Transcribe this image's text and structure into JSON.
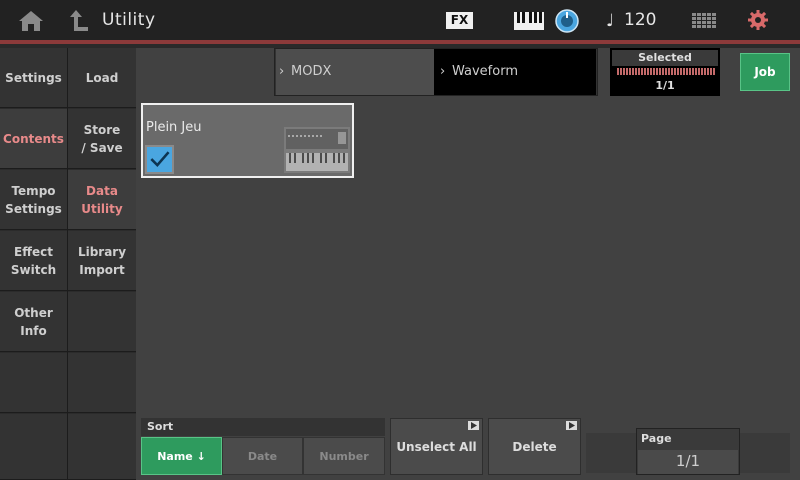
{
  "header": {
    "title": "Utility",
    "fx_label": "FX",
    "tempo_note": "♩",
    "tempo": "120"
  },
  "nav_left": [
    {
      "label": "Settings",
      "active": false
    },
    {
      "label": "Contents",
      "active": true
    },
    {
      "label": "Tempo\nSettings",
      "active": false
    },
    {
      "label": "Effect\nSwitch",
      "active": false
    },
    {
      "label": "Other\nInfo",
      "active": false
    }
  ],
  "nav_right": [
    {
      "label": "Load",
      "active": false
    },
    {
      "label": "Store\n/ Save",
      "active": false
    },
    {
      "label": "Data\nUtility",
      "active": true
    },
    {
      "label": "Library\nImport",
      "active": false
    }
  ],
  "breadcrumb": {
    "item1": "MODX",
    "item2": "Waveform"
  },
  "selected": {
    "label": "Selected",
    "count": "1/1"
  },
  "job_label": "Job",
  "tile": {
    "name": "Plein Jeu",
    "checked": true
  },
  "sort": {
    "label": "Sort",
    "options": [
      "Name ↓",
      "Date",
      "Number"
    ],
    "active_index": 0
  },
  "actions": {
    "unselect_all": "Unselect All",
    "delete": "Delete"
  },
  "page": {
    "label": "Page",
    "value": "1/1"
  },
  "colors": {
    "accent_green": "#2e9b5e",
    "accent_red": "#e88a8a",
    "check_blue": "#4aa6e0"
  }
}
